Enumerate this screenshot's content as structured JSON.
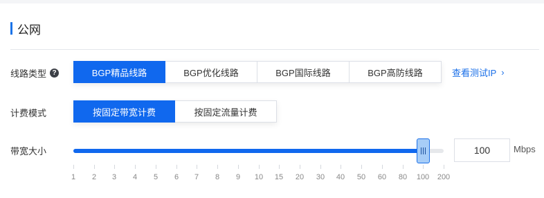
{
  "section": {
    "title": "公网"
  },
  "line_type": {
    "label": "线路类型",
    "help_icon": "question-circle-icon",
    "options": [
      "BGP精品线路",
      "BGP优化线路",
      "BGP国际线路",
      "BGP高防线路"
    ],
    "selected": 0,
    "link_text": "查看测试IP",
    "link_icon": "chevron-right-icon"
  },
  "billing": {
    "label": "计费模式",
    "options": [
      "按固定带宽计费",
      "按固定流量计费"
    ],
    "selected": 0
  },
  "bandwidth": {
    "label": "带宽大小",
    "value": "100",
    "unit": "Mbps",
    "ticks": [
      "1",
      "2",
      "3",
      "4",
      "5",
      "6",
      "7",
      "8",
      "9",
      "10",
      "15",
      "20",
      "30",
      "40",
      "50",
      "60",
      "80",
      "100",
      "200"
    ],
    "selected_tick": "100",
    "handle_icon": "drag-handle-icon"
  },
  "colors": {
    "accent": "#1068ee",
    "link": "#1a6fe8"
  }
}
